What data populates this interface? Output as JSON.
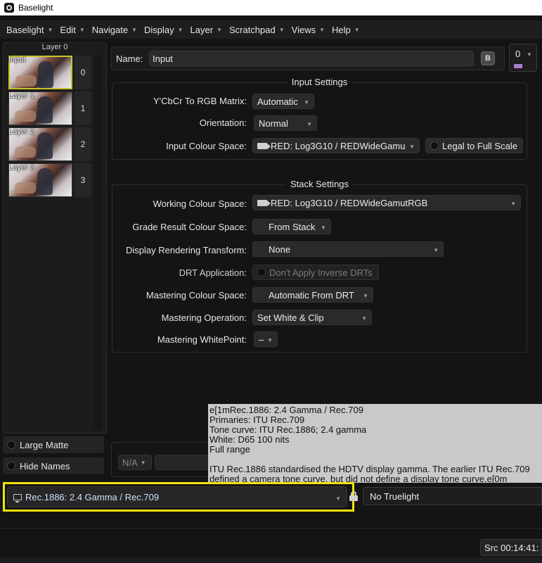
{
  "window": {
    "title": "Baselight"
  },
  "menu": [
    {
      "label": "Baselight"
    },
    {
      "label": "Edit"
    },
    {
      "label": "Navigate"
    },
    {
      "label": "Display"
    },
    {
      "label": "Layer"
    },
    {
      "label": "Scratchpad"
    },
    {
      "label": "Views"
    },
    {
      "label": "Help"
    }
  ],
  "layers": {
    "header": "Layer 0",
    "items": [
      {
        "label": "Input",
        "number": "0",
        "selected": true
      },
      {
        "label": "Layer 1",
        "number": "1"
      },
      {
        "label": "Layer 2",
        "number": "2"
      },
      {
        "label": "Layer 3",
        "number": "3"
      }
    ],
    "large_matte": "Large Matte",
    "hide_names": "Hide Names"
  },
  "name": {
    "label": "Name:",
    "value": "Input",
    "b_button": "B"
  },
  "corner": {
    "value": "0"
  },
  "input_settings": {
    "title": "Input Settings",
    "ycbcr_label": "Y'CbCr To RGB Matrix:",
    "ycbcr_value": "Automatic",
    "orientation_label": "Orientation:",
    "orientation_value": "Normal",
    "colour_space_label": "Input Colour Space:",
    "colour_space_value": "RED: Log3G10 / REDWideGamu",
    "legal_to_full": "Legal to Full Scale"
  },
  "stack_settings": {
    "title": "Stack Settings",
    "working_label": "Working Colour Space:",
    "working_value": "RED: Log3G10 / REDWideGamutRGB",
    "grade_result_label": "Grade Result Colour Space:",
    "grade_result_value": "From Stack",
    "drt_label": "Display Rendering Transform:",
    "drt_value": "None",
    "drt_app_label": "DRT Application:",
    "drt_app_value": "Don't Apply Inverse DRTs",
    "mastering_cs_label": "Mastering Colour Space:",
    "mastering_cs_value": "Automatic From DRT",
    "mastering_op_label": "Mastering Operation:",
    "mastering_op_value": "Set White & Clip",
    "mastering_wp_label": "Mastering WhitePoint:",
    "mastering_wp_value": "–"
  },
  "lower": {
    "na_value": "N/A"
  },
  "tooltip": {
    "lines": [
      "e[1mRec.1886: 2.4 Gamma / Rec.709",
      "Primaries: ITU Rec.709",
      "Tone curve: ITU Rec.1886; 2.4 gamma",
      "White: D65 100 nits",
      "Full range",
      "",
      "ITU Rec.1886 standardised the HDTV display gamma. The earlier ITU Rec.709",
      "defined a camera tone curve, but did not define a display tone curve.e[0m"
    ]
  },
  "display": {
    "value": "Rec.1886: 2.4 Gamma / Rec.709",
    "truelight": "No Truelight"
  },
  "src": {
    "label": "Src 00:14:41:"
  },
  "colors": {
    "highlight": "#f1e20b",
    "selected_thumb": "#c8c22b",
    "tooltip_bg": "#c9c9c9"
  }
}
